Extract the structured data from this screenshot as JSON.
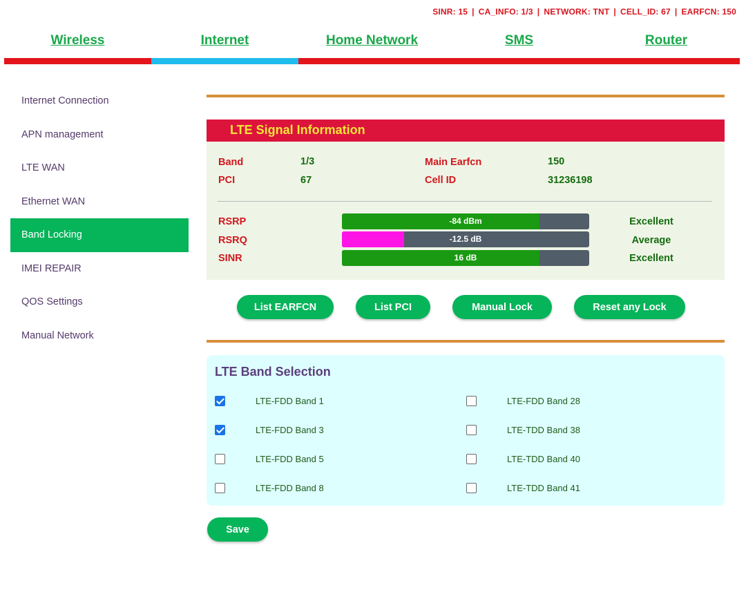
{
  "status": {
    "sinr": "SINR:  15",
    "ca_info": "CA_INFO:  1/3",
    "network": "NETWORK:  TNT",
    "cell_id": "CELL_ID:  67",
    "earfcn": "EARFCN:  150",
    "separator": "|"
  },
  "nav": {
    "items": [
      "Wireless",
      "Internet",
      "Home Network",
      "SMS",
      "Router"
    ],
    "active": "Internet",
    "colors": {
      "bar": "#e3141c",
      "active_bar": "#1fbcee",
      "text": "#1aa84a"
    }
  },
  "sidebar": {
    "items": [
      "Internet Connection",
      "APN management",
      "LTE WAN",
      "Ethernet WAN",
      "Band Locking",
      "IMEI REPAIR",
      "QOS Settings",
      "Manual Network"
    ],
    "active": "Band Locking"
  },
  "signal": {
    "title": "LTE Signal Information",
    "band_label": "Band",
    "band_value": "1/3",
    "pci_label": "PCI",
    "pci_value": "67",
    "earfcn_label": "Main Earfcn",
    "earfcn_value": "150",
    "cellid_label": "Cell ID",
    "cellid_value": "31236198",
    "meters": [
      {
        "label": "RSRP",
        "text": "-84 dBm",
        "level": 0.8,
        "color": "#1a9a12",
        "quality": "Excellent"
      },
      {
        "label": "RSRQ",
        "text": "-12.5 dB",
        "level": 0.25,
        "color": "#ff14e6",
        "quality": "Average"
      },
      {
        "label": "SINR",
        "text": "16 dB",
        "level": 0.8,
        "color": "#1a9a12",
        "quality": "Excellent"
      }
    ]
  },
  "actions": {
    "list_earfcn": "List EARFCN",
    "list_pci": "List PCI",
    "manual_lock": "Manual Lock",
    "reset_lock": "Reset any Lock"
  },
  "bands": {
    "title": "LTE Band Selection",
    "left": [
      {
        "label": "LTE-FDD Band 1",
        "checked": true
      },
      {
        "label": "LTE-FDD Band 3",
        "checked": true
      },
      {
        "label": "LTE-FDD Band 5",
        "checked": false
      },
      {
        "label": "LTE-FDD Band 8",
        "checked": false
      }
    ],
    "right": [
      {
        "label": "LTE-FDD Band 28",
        "checked": false
      },
      {
        "label": "LTE-TDD Band 38",
        "checked": false
      },
      {
        "label": "LTE-TDD Band 40",
        "checked": false
      },
      {
        "label": "LTE-TDD Band 41",
        "checked": false
      }
    ]
  },
  "save_label": "Save"
}
